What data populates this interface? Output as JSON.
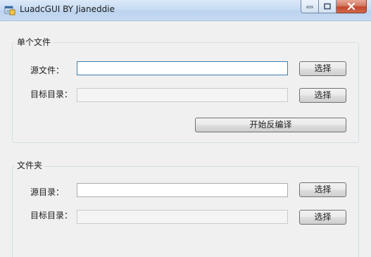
{
  "window": {
    "title": "LuadcGUI BY Jianeddie"
  },
  "single_file_group": {
    "title": "单个文件",
    "source_file_label": "源文件：",
    "source_file_value": "",
    "target_dir_label": "目标目录：",
    "target_dir_value": "",
    "select_label_1": "选择",
    "select_label_2": "选择",
    "decompile_label": "开始反编译"
  },
  "folder_group": {
    "title": "文件夹",
    "source_dir_label": "源目录：",
    "source_dir_value": "",
    "target_dir_label": "目标目录：",
    "target_dir_value": "",
    "select_label_1": "选择",
    "select_label_2": "选择"
  }
}
